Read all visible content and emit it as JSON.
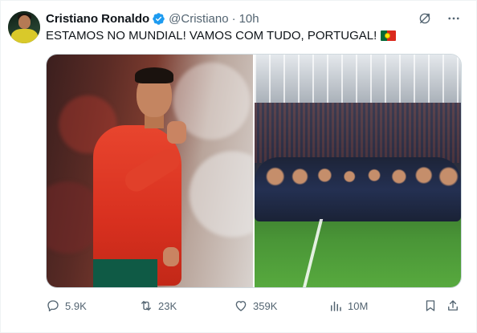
{
  "tweet": {
    "author": {
      "name": "Cristiano Ronaldo",
      "handle": "@Cristiano",
      "separator": "·",
      "time": "10h",
      "verified_color": "#1d9bf0"
    },
    "text": "ESTAMOS NO MUNDIAL! VAMOS COM TUDO, PORTUGAL!",
    "flag_emoji": "portugal-flag",
    "actions": {
      "reply_count": "5.9K",
      "retweet_count": "23K",
      "like_count": "359K",
      "view_count": "10M"
    }
  },
  "icons": {
    "grok": "grok-icon",
    "more": "more-icon",
    "reply": "reply-icon",
    "retweet": "retweet-icon",
    "like": "heart-icon",
    "views": "views-icon",
    "bookmark": "bookmark-icon",
    "share": "share-icon"
  },
  "colors": {
    "text_primary": "#0f1419",
    "text_secondary": "#536471",
    "border": "#cfd9de"
  }
}
